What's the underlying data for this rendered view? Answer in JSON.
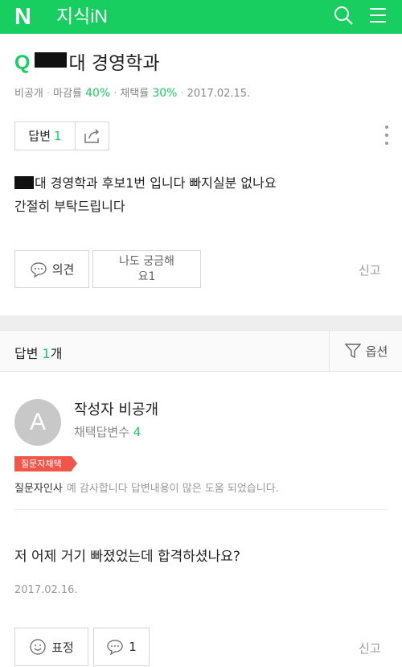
{
  "header": {
    "logo": "N",
    "service_name": "지식iN",
    "search_icon": "search-icon",
    "menu_icon": "hamburger-menu-icon",
    "color": "#19ce60"
  },
  "question": {
    "q_mark": "Q",
    "title_visible": "대 경영학과",
    "visibility": "비공개",
    "deadline_label": "마감률",
    "deadline_value": "40%",
    "adopt_label": "채택률",
    "adopt_value": "30%",
    "date": "2017.02.15.",
    "answer_label": "답변",
    "answer_count": "1",
    "body_line1": "대 경영학과 후보1번 입니다 빠지실분 없나요",
    "body_line2": "간절히 부탁드립니다",
    "opinion_button": "의견",
    "metoo_line1": "나도 궁금해",
    "metoo_line2": "요1",
    "report": "신고"
  },
  "answers_section": {
    "label": "답변",
    "count": "1",
    "count_suffix": "개",
    "options": "옵션"
  },
  "answer": {
    "avatar_letter": "A",
    "author": "작성자 비공개",
    "adopt_label": "채택답변수",
    "adopt_count": "4",
    "badge": "질문자채택",
    "thanks_label": "질문자인사",
    "thanks_text": "예 감사합니다 답변내용이 많은 도움 되었습니다.",
    "body": "저 어제 거기 빠졌었는데 합격하셨나요?",
    "date": "2017.02.16.",
    "emotion_button": "표정",
    "comment_count": "1",
    "report": "신고"
  }
}
